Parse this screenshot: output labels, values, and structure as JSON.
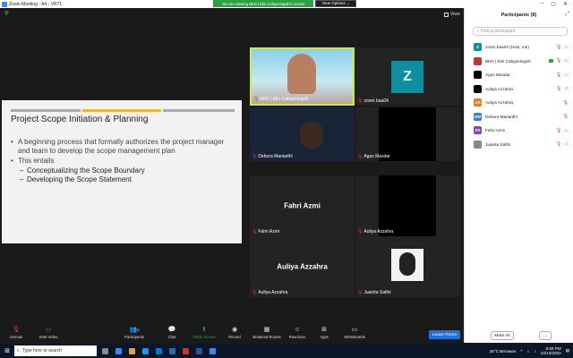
{
  "window": {
    "title": "Zoom Meeting - A4 - VR71",
    "share_banner": "You are viewing BKN | Elin Cahyaningsih's screen",
    "view_options": "View Options ⌄",
    "view": "View"
  },
  "slide": {
    "title": "Project Scope Initiation & Planning",
    "bullets": [
      "A beginning process that formally  authorizes the project manager and team to develop the scope management plan",
      "This entails"
    ],
    "sub_bullets": [
      "Conceptualizing the Scope Boundary",
      "Developing the Scope Statement"
    ],
    "bar_colors": [
      "#a9a9a9",
      "#f0b43c",
      "#a9a9a9"
    ]
  },
  "tiles": {
    "t1": "BKN | Elin Cahyaningsih",
    "t2": "zoom baa04",
    "t2_initial": "Z",
    "t3": "Debora Marianthi",
    "t4": "Agus Masdar",
    "t5_big": "Fahri Azmi",
    "t5": "Fahri Azmi",
    "t6": "Auliya Azzahra",
    "t7_big": "Auliya Azzahra",
    "t7": "Auliya Azzahra",
    "t8": "Juanita Safitri"
  },
  "panel": {
    "title": "Participants (8)",
    "search_placeholder": "Find a participant",
    "participants": [
      {
        "name": "zoom baa04 (Host, me)",
        "initials": "Z",
        "color": "#0e8fa0"
      },
      {
        "name": "BKN | Elin Cahyaningsih",
        "initials": "",
        "color": "#c0392b"
      },
      {
        "name": "Agus Masdar",
        "initials": "",
        "color": "#000000"
      },
      {
        "name": "Auliya Azzahra",
        "initials": "",
        "color": "#000000"
      },
      {
        "name": "Auliya Azzahra",
        "initials": "AA",
        "color": "#e67e22"
      },
      {
        "name": "Debora Marianthi",
        "initials": "DM",
        "color": "#3a7bd5"
      },
      {
        "name": "Fahri Azmi",
        "initials": "FA",
        "color": "#8e44ad"
      },
      {
        "name": "Juanita Safitri",
        "initials": "",
        "color": "#888888"
      }
    ],
    "mute_all": "Mute All",
    "more": "..."
  },
  "toolbar": {
    "unmute": "Unmute",
    "start_video": "Start Video",
    "participants": "Participants",
    "participants_count": "8",
    "chat": "Chat",
    "share_screen": "Share Screen",
    "record": "Record",
    "breakout": "Breakout Rooms",
    "reactions": "Reactions",
    "apps": "Apps",
    "whiteboards": "Whiteboards",
    "leave": "Leave Room"
  },
  "taskbar": {
    "search_placeholder": "Type here to search",
    "weather": "28°C  Berawan",
    "time": "6:59 PM",
    "date": "10/13/2022"
  }
}
